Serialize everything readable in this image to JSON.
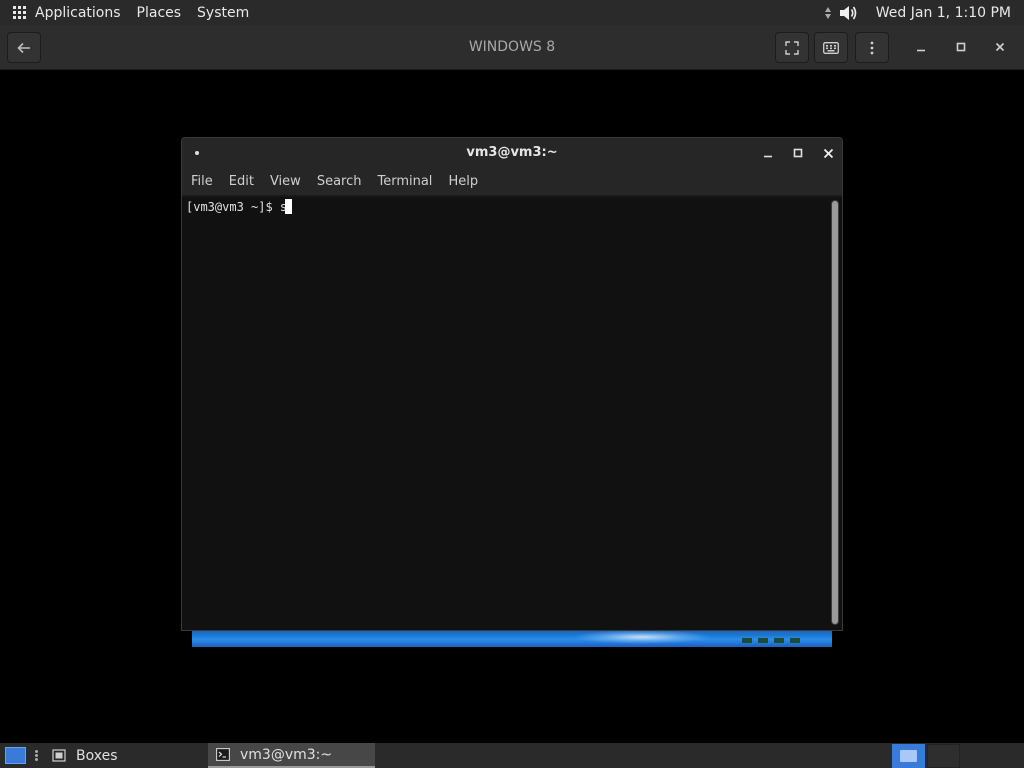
{
  "top_panel": {
    "menus": [
      "Applications",
      "Places",
      "System"
    ],
    "clock": "Wed Jan  1,  1:10 PM"
  },
  "boxes": {
    "title": "WINDOWS 8",
    "buttons": {
      "back": "back-arrow-icon",
      "fullscreen": "fullscreen-icon",
      "keyboard": "keyboard-icon",
      "menu": "kebab-menu-icon"
    }
  },
  "terminal": {
    "title": "vm3@vm3:~",
    "menu": [
      "File",
      "Edit",
      "View",
      "Search",
      "Terminal",
      "Help"
    ],
    "prompt": "[vm3@vm3 ~]$ ",
    "input": "s"
  },
  "taskbar": {
    "tasks": [
      {
        "label": "Boxes",
        "icon": "boxes-app-icon",
        "active": false
      },
      {
        "label": "vm3@vm3:~",
        "icon": "terminal-app-icon",
        "active": true
      }
    ]
  },
  "colors": {
    "panel": "#2a2a2a",
    "workspace_accent": "#3a7ad9"
  }
}
